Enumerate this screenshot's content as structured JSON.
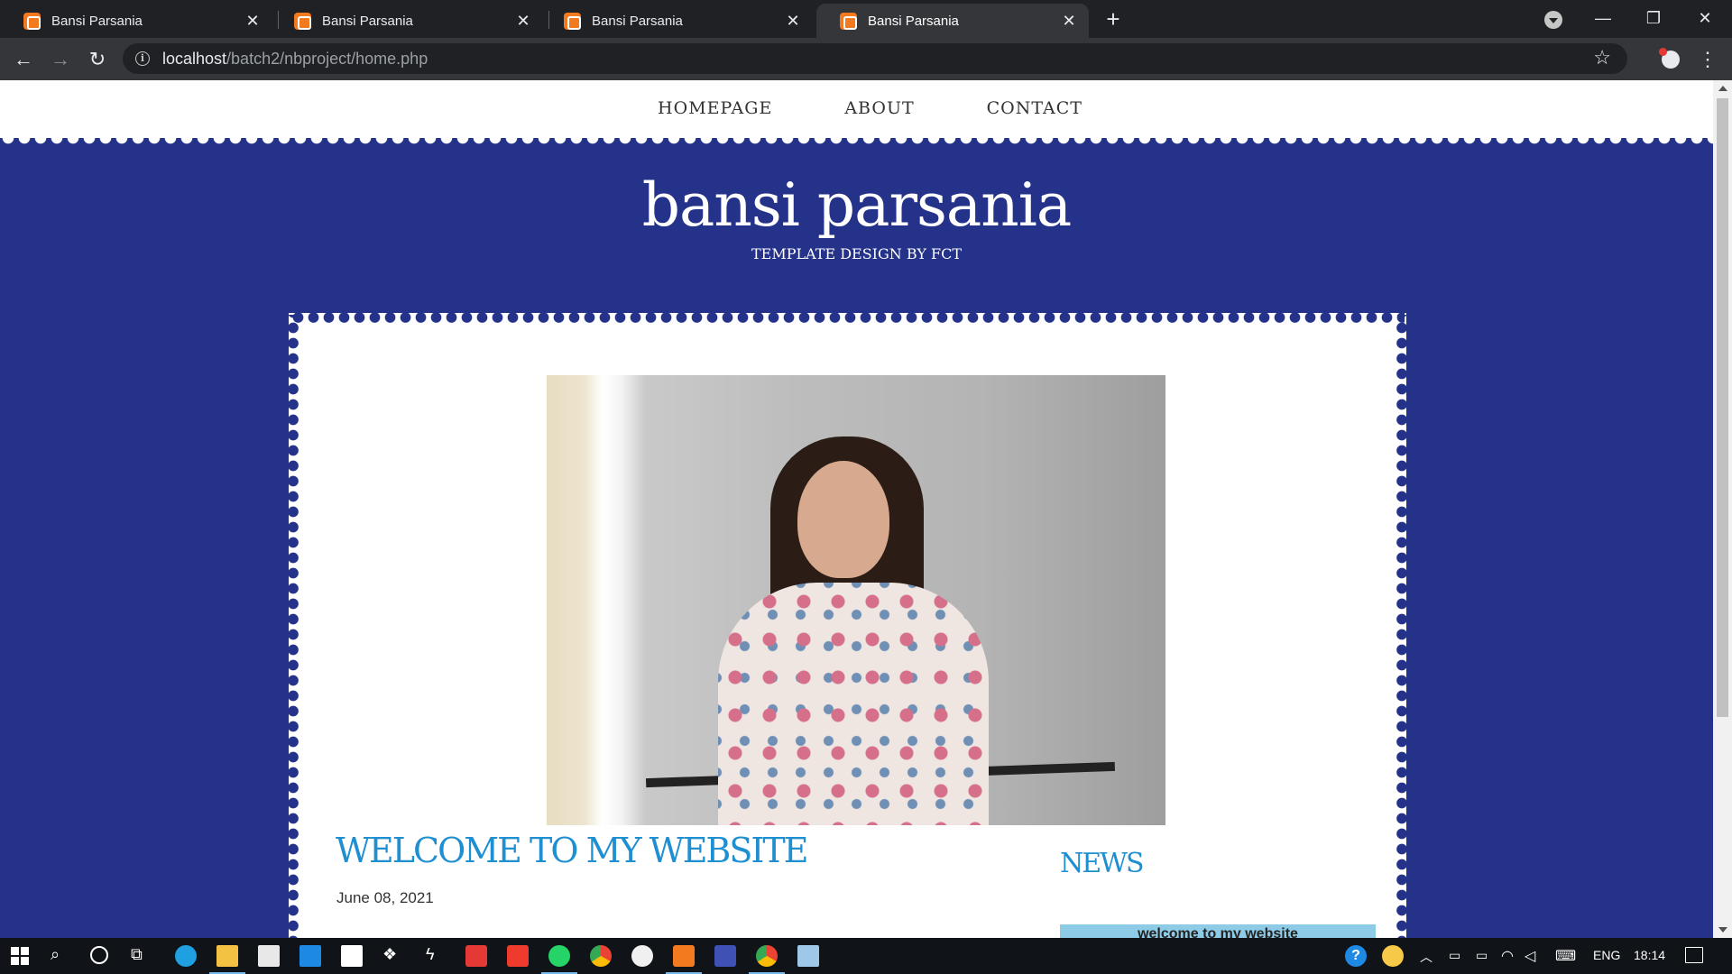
{
  "browser": {
    "tabs": [
      {
        "title": "Bansi Parsania",
        "active": false
      },
      {
        "title": "Bansi Parsania",
        "active": false
      },
      {
        "title": "Bansi Parsania",
        "active": false
      },
      {
        "title": "Bansi Parsania",
        "active": true
      }
    ],
    "url_host": "localhost",
    "url_path": "/batch2/nbproject/home.php"
  },
  "site": {
    "nav": [
      "HOMEPAGE",
      "ABOUT",
      "CONTACT"
    ],
    "title": "bansi parsania",
    "tagline": "TEMPLATE DESIGN BY FCT",
    "post_title": "WELCOME TO MY WEBSITE",
    "post_date": "June 08, 2021",
    "news_heading": "NEWS",
    "news_item": "welcome to my website"
  },
  "taskbar": {
    "language": "ENG",
    "time": "18:14"
  },
  "colors": {
    "page_background": "#24328a",
    "heading_blue": "#1e8fd1",
    "news_box": "#8ecbe6",
    "favicon_orange": "#f47a20"
  },
  "icons": [
    "xampp-favicon",
    "close-icon",
    "new-tab-icon",
    "tab-search-icon",
    "minimize-icon",
    "restore-icon",
    "window-close-icon",
    "back-icon",
    "forward-icon",
    "reload-icon",
    "site-info-icon",
    "bookmark-star-icon",
    "extension-icon",
    "browser-menu-icon",
    "windows-start-icon",
    "search-icon",
    "cortana-icon",
    "task-view-icon",
    "edge-icon",
    "file-explorer-icon",
    "store-icon",
    "mail-icon",
    "amazon-icon",
    "dropbox-icon",
    "winamp-icon",
    "gmail-icon",
    "anydesk-icon",
    "whatsapp-icon",
    "chrome-icon",
    "github-icon",
    "xampp-icon",
    "app-icon",
    "notepad-icon",
    "help-icon",
    "weather-icon",
    "notification-icon"
  ]
}
